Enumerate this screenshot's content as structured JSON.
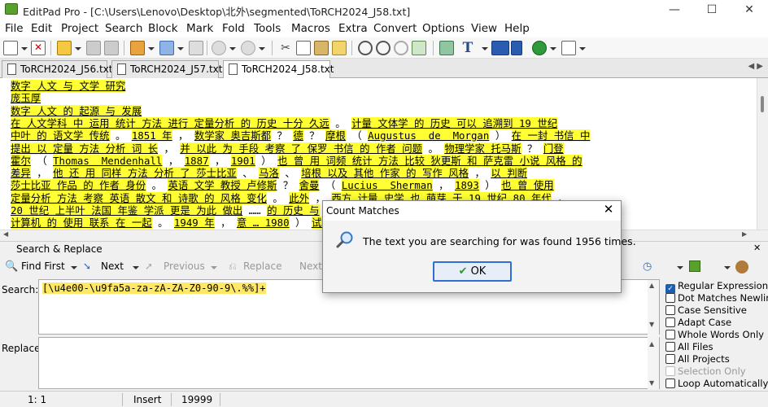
{
  "window": {
    "title": "EditPad Pro - [C:\\Users\\Lenovo\\Desktop\\北外\\segmented\\ToRCH2024_J58.txt]",
    "minimize": "—",
    "maximize": "☐",
    "close": "✕"
  },
  "menu": [
    "File",
    "Edit",
    "Project",
    "Search",
    "Block",
    "Mark",
    "Fold",
    "Tools",
    "Macros",
    "Extra",
    "Convert",
    "Options",
    "View",
    "Help"
  ],
  "tabs": [
    "ToRCH2024_J56.txt",
    "ToRCH2024_J57.txt",
    "ToRCH2024_J58.txt"
  ],
  "editor_lines": [
    [
      {
        "t": "数字 人文 与 文学 研究",
        "h": true
      }
    ],
    [
      {
        "t": "庞玉厚",
        "h": true
      }
    ],
    [
      {
        "t": "数字 人文 的 起源 与 发展",
        "h": true
      }
    ],
    [
      {
        "t": "在 人文学科 中 运用 统计 方法 进行 定量分析 的 历史 十分 久远",
        "h": true
      },
      {
        "t": " 。 ",
        "h": false
      },
      {
        "t": "计量 文体学 的 历史 可以 追溯到 19 世纪",
        "h": true
      }
    ],
    [
      {
        "t": "中叶 的 语文学 传统",
        "h": true
      },
      {
        "t": " 。 ",
        "h": false
      },
      {
        "t": "1851 年",
        "h": true
      },
      {
        "t": " ， ",
        "h": false
      },
      {
        "t": "数学家 奥吉斯都",
        "h": true
      },
      {
        "t": " ？ ",
        "h": false
      },
      {
        "t": "德",
        "h": true
      },
      {
        "t": " ？ ",
        "h": false
      },
      {
        "t": "摩根",
        "h": true
      },
      {
        "t": " （ ",
        "h": false
      },
      {
        "t": "Augustus  de  Morgan",
        "h": true
      },
      {
        "t": " ） ",
        "h": false
      },
      {
        "t": "在 一封 书信 中",
        "h": true
      }
    ],
    [
      {
        "t": "提出 以 定量 方法 分析 词 长",
        "h": true
      },
      {
        "t": " ， ",
        "h": false
      },
      {
        "t": "并 以此 为 手段 考察 了 保罗 书信 的 作者 问题",
        "h": true
      },
      {
        "t": " 。 ",
        "h": false
      },
      {
        "t": "物理学家 托马斯",
        "h": true
      },
      {
        "t": " ？ ",
        "h": false
      },
      {
        "t": "门登",
        "h": true
      }
    ],
    [
      {
        "t": "霍尔",
        "h": true
      },
      {
        "t": " （ ",
        "h": false
      },
      {
        "t": "Thomas  Mendenhall",
        "h": true
      },
      {
        "t": " ， ",
        "h": false
      },
      {
        "t": "1887",
        "h": true
      },
      {
        "t": " ， ",
        "h": false
      },
      {
        "t": "1901",
        "h": true
      },
      {
        "t": " ） ",
        "h": false
      },
      {
        "t": "也 曾 用 词频 统计 方法 比较 狄更斯 和 萨克雷 小说 风格 的",
        "h": true
      }
    ],
    [
      {
        "t": "差异",
        "h": true
      },
      {
        "t": " ， ",
        "h": false
      },
      {
        "t": "他 还 用 同样 方法 分析 了 莎士比亚",
        "h": true
      },
      {
        "t": " 、 ",
        "h": false
      },
      {
        "t": "马洛",
        "h": true
      },
      {
        "t": " 、 ",
        "h": false
      },
      {
        "t": "培根 以及 其他 作家 的 写作 风格",
        "h": true
      },
      {
        "t": " ， ",
        "h": false
      },
      {
        "t": "以 判断",
        "h": true
      }
    ],
    [
      {
        "t": "莎士比亚 作品 的 作者 身份",
        "h": true
      },
      {
        "t": " 。 ",
        "h": false
      },
      {
        "t": "英语 文学 教授 卢修斯",
        "h": true
      },
      {
        "t": " ？ ",
        "h": false
      },
      {
        "t": "舍曼",
        "h": true
      },
      {
        "t": " （ ",
        "h": false
      },
      {
        "t": "Lucius  Sherman",
        "h": true
      },
      {
        "t": " ， ",
        "h": false
      },
      {
        "t": "1893",
        "h": true
      },
      {
        "t": " ） ",
        "h": false
      },
      {
        "t": "也 曾 使用",
        "h": true
      }
    ],
    [
      {
        "t": "定量分析 方法 考察 英语 散文 和 诗歌 的 风格 变化",
        "h": true
      },
      {
        "t": " 。 ",
        "h": false
      },
      {
        "t": "此外",
        "h": true
      },
      {
        "t": " ， ",
        "h": false
      },
      {
        "t": "西方 计量 史学 也 萌芽 于 19 世纪 80 年代",
        "h": true
      },
      {
        "t": " ，",
        "h": false
      }
    ],
    [
      {
        "t": "20 世纪 上半叶 法国 年鉴 学派 更是 为此 做出",
        "h": true
      },
      {
        "t": " …… ",
        "h": false
      },
      {
        "t": "的 历史 与",
        "h": true
      }
    ],
    [
      {
        "t": "计算机 的 使用 联系 在 一起",
        "h": true
      },
      {
        "t": " 。 ",
        "h": false
      },
      {
        "t": "1949 年",
        "h": true
      },
      {
        "t": " ， ",
        "h": false
      },
      {
        "t": "意 … 1980",
        "h": true
      },
      {
        "t": " ） ",
        "h": false
      },
      {
        "t": "试图 借助",
        "h": true
      }
    ]
  ],
  "search_replace": {
    "title": "Search & Replace",
    "find_first": "Find First",
    "next": "Next",
    "previous": "Previous",
    "replace": "Replace",
    "replace_next": "Next",
    "search_label": "Search:",
    "search_value": "[\\u4e00-\\u9fa5a-za-zA-ZA-Z0-90-9\\.%%]+",
    "replace_label": "Replace:",
    "replace_value": "",
    "options": [
      {
        "label": "Regular Expression",
        "checked": true,
        "disabled": false
      },
      {
        "label": "Dot Matches Newline",
        "checked": false,
        "disabled": false
      },
      {
        "label": "Case Sensitive",
        "checked": false,
        "disabled": false
      },
      {
        "label": "Adapt Case",
        "checked": false,
        "disabled": false
      },
      {
        "label": "Whole Words Only",
        "checked": false,
        "disabled": false
      },
      {
        "label": "All Files",
        "checked": false,
        "disabled": false
      },
      {
        "label": "All Projects",
        "checked": false,
        "disabled": false
      },
      {
        "label": "Selection Only",
        "checked": false,
        "disabled": true
      },
      {
        "label": "Loop Automatically",
        "checked": false,
        "disabled": false
      }
    ]
  },
  "status": {
    "position": "1: 1",
    "mode": "Insert",
    "length": "19999"
  },
  "dialog": {
    "title": "Count Matches",
    "message": "The text you are searching for was found 1956 times.",
    "ok": "OK",
    "close": "✕"
  },
  "colors": {
    "highlight": "#ffff33",
    "accent": "#1a5fb4",
    "app_icon": "#5aa02c"
  }
}
